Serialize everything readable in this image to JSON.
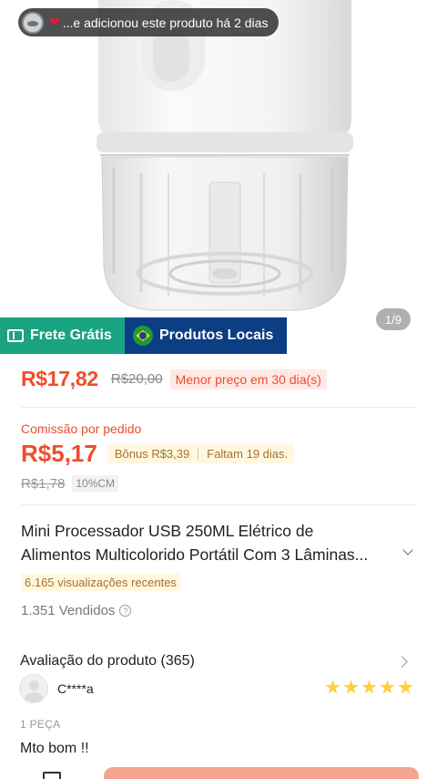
{
  "hero": {
    "notification_text": "...e adicionou este produto há 2 dias",
    "image_counter": "1/9",
    "badge_frete": "Frete Grátis",
    "badge_locais": "Produtos Locais"
  },
  "price": {
    "current": "R$17,82",
    "original": "R$20,00",
    "lowest_label": "Menor preço em 30 dia(s)"
  },
  "commission": {
    "label": "Comissão por pedido",
    "value": "R$5,17",
    "bonus": "Bônus R$3,39",
    "remaining": "Faltam 19 dias.",
    "old_value": "R$1,78",
    "percent": "10%CM"
  },
  "product": {
    "title_line1": "Mini Processador USB 250ML Elétrico de",
    "title_line2": "Alimentos Multicolorido Portátil Com 3 Lâminas...",
    "recent_views": "6.165 visualizações recentes",
    "sold": "1.351 Vendidos"
  },
  "reviews": {
    "title": "Avaliação do produto (365)",
    "reviewer_name": "C****a",
    "rating": 5,
    "variant": "1 PEÇA",
    "comment": "Mto bom !!"
  },
  "colors": {
    "accent": "#ee4d2d",
    "frete_badge": "#1aa382",
    "locais_badge": "#0c3e83",
    "star": "#ffce3d"
  }
}
